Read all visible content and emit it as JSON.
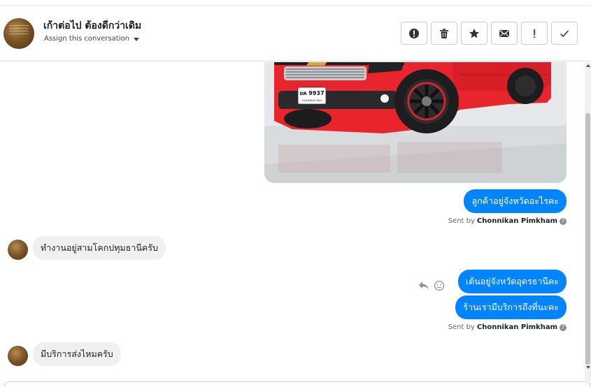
{
  "conversation": {
    "title": "เก้าต่อไป ต้องดีกว่าเดิม",
    "assign_label": "Assign this conversation"
  },
  "toolbar": {
    "icons": [
      "alert-circle-icon",
      "trash-icon",
      "star-icon",
      "envelope-icon",
      "exclamation-icon",
      "checkmark-icon"
    ],
    "accent_color": "#e02020"
  },
  "messages": {
    "out_1": "ลูกค้าอยู่จังหวัดอะไรคะ",
    "sent_by_1_prefix": "Sent by",
    "sent_by_1_name": "Chonnikan Pimkham",
    "in_1": "ทำงานอยู่สามโคกปทุมธานีครับ",
    "out_2": "เต้นอยู่จังหวัดอุดรธานีคะ",
    "out_3": "ร้านเรามีบริการถึงที่นะคะ",
    "sent_by_2_prefix": "Sent by",
    "sent_by_2_name": "Chonnikan Pimkham",
    "in_2": "มีบริการส่งไหมครับ",
    "help_glyph": "?"
  },
  "photo": {
    "plate_line1": "ยค 9937",
    "plate_line2": "กรุงเทพมหานคร"
  },
  "colors": {
    "outgoing_bubble": "#0084ff",
    "incoming_bubble": "#f0f0f0",
    "car_red": "#e8242c"
  }
}
